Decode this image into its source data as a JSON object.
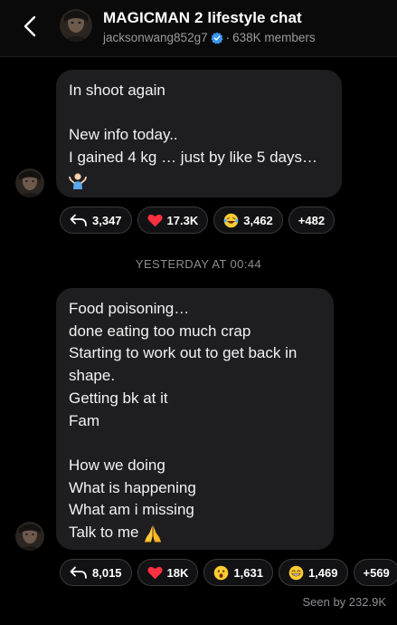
{
  "header": {
    "title": "MAGICMAN 2 lifestyle chat",
    "username": "jacksonwang852g7",
    "separator": "·",
    "members": "638K members",
    "back_icon": "chevron-left-icon",
    "verified_icon": "verified-badge-icon"
  },
  "messages": [
    {
      "lines": [
        "In shoot again",
        "",
        "New info today..",
        "I gained 4 kg … just by like 5 days…"
      ],
      "trailing_emoji": "person-shrugging-emoji",
      "reactions": {
        "reply": "3,347",
        "heart": "17.3K",
        "laugh": "3,462",
        "more": "+482"
      }
    },
    {
      "lines": [
        "Food poisoning…",
        "done eating too much crap",
        "Starting to work out to get back in",
        "shape.",
        "Getting bk at it",
        "Fam",
        "",
        "How we doing",
        "What is happening",
        "What am i missing",
        "Talk to me"
      ],
      "trailing_emoji": "folded-hands-emoji",
      "reactions": {
        "reply": "8,015",
        "heart": "18K",
        "wow": "1,631",
        "grin": "1,469",
        "more": "+569"
      }
    }
  ],
  "date_divider": "YESTERDAY AT 00:44",
  "seen": "Seen by 232.9K",
  "colors": {
    "background": "#000000",
    "bubble": "#1e1e20",
    "verified": "#3797f0",
    "heart": "#ff3040",
    "muted": "#8e8e93"
  }
}
